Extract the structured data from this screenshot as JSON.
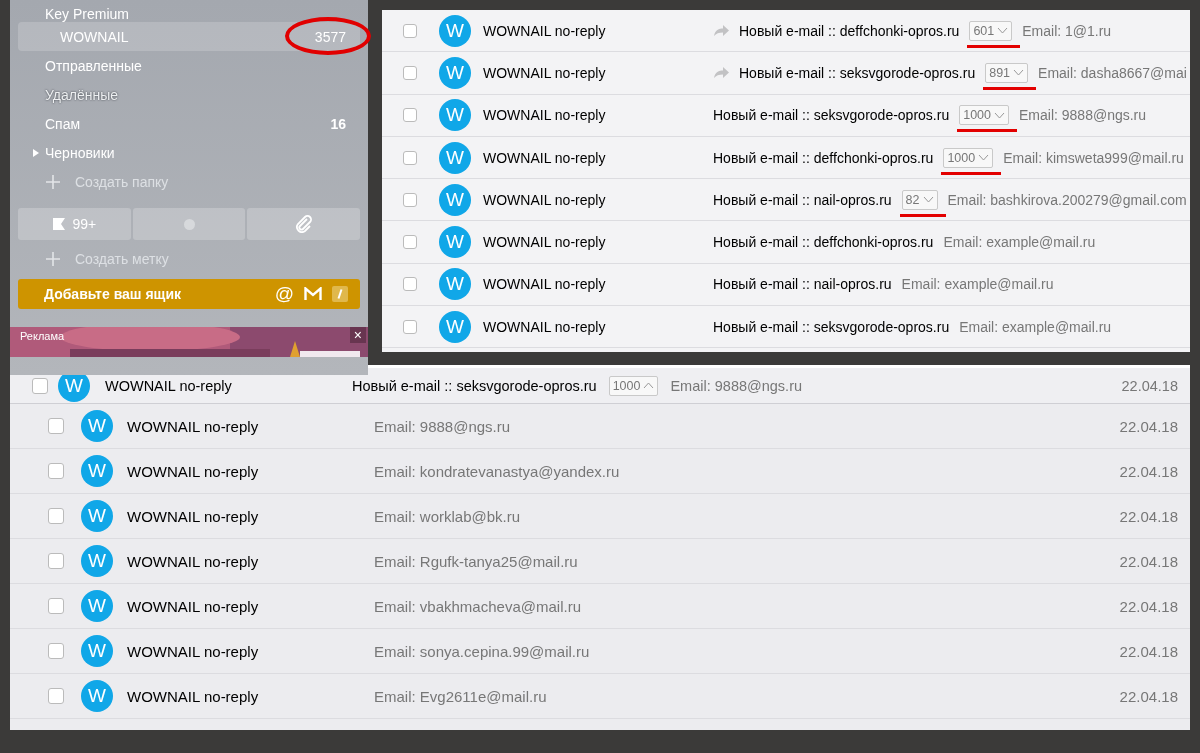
{
  "sidebar": {
    "folders": [
      {
        "kind": "folder",
        "label": "Key Premium",
        "selected": false,
        "dimmed": false
      },
      {
        "kind": "folder",
        "label": "WOWNAIL",
        "count": "3577",
        "selected": true,
        "dimmed": false,
        "annotated": true
      },
      {
        "kind": "folder",
        "label": "Отправленные",
        "selected": false,
        "dimmed": false
      },
      {
        "kind": "folder",
        "label": "Удалённые",
        "selected": false,
        "dimmed": true
      },
      {
        "kind": "folder",
        "label": "Спам",
        "count": "16",
        "selected": false,
        "dimmed": false
      },
      {
        "kind": "tree",
        "label": "Черновики",
        "selected": false,
        "dimmed": false,
        "expanded": false
      },
      {
        "kind": "create",
        "label": "Создать папку"
      }
    ],
    "label_filters": [
      {
        "kind": "flag",
        "label": "99+"
      },
      {
        "kind": "dot"
      },
      {
        "kind": "clip"
      }
    ],
    "create_label": "Создать метку",
    "add_mailbox": {
      "label": "Добавьте ваш ящик",
      "icons": [
        "@"
      ]
    },
    "ad": {
      "label": "Реклама",
      "close": "×"
    }
  },
  "top_list": [
    {
      "avatar": "W",
      "sender": "WOWNAIL no-reply",
      "forwarded": true,
      "subject": "Новый e-mail :: deffchonki-opros.ru",
      "count": "601",
      "expanded": false,
      "annotated": true,
      "snippet": "Email: 1@1.ru",
      "checked": false
    },
    {
      "avatar": "W",
      "sender": "WOWNAIL no-reply",
      "forwarded": true,
      "subject": "Новый e-mail :: seksvgorode-opros.ru",
      "count": "891",
      "expanded": false,
      "annotated": true,
      "snippet": "Email: dasha8667@mai",
      "checked": false
    },
    {
      "avatar": "W",
      "sender": "WOWNAIL no-reply",
      "forwarded": false,
      "subject": "Новый e-mail :: seksvgorode-opros.ru",
      "count": "1000",
      "expanded": false,
      "annotated": true,
      "snippet": "Email: 9888@ngs.ru",
      "checked": false
    },
    {
      "avatar": "W",
      "sender": "WOWNAIL no-reply",
      "forwarded": false,
      "subject": "Новый e-mail :: deffchonki-opros.ru",
      "count": "1000",
      "expanded": false,
      "annotated": true,
      "snippet": "Email: kimsweta999@mail.ru",
      "checked": false
    },
    {
      "avatar": "W",
      "sender": "WOWNAIL no-reply",
      "forwarded": false,
      "subject": "Новый e-mail :: nail-opros.ru",
      "count": "82",
      "expanded": false,
      "annotated": true,
      "snippet": "Email: bashkirova.200279@gmail.com",
      "checked": false
    },
    {
      "avatar": "W",
      "sender": "WOWNAIL no-reply",
      "forwarded": false,
      "subject": "Новый e-mail :: deffchonki-opros.ru",
      "snippet": "Email: example@mail.ru",
      "checked": false
    },
    {
      "avatar": "W",
      "sender": "WOWNAIL no-reply",
      "forwarded": false,
      "subject": "Новый e-mail :: nail-opros.ru",
      "snippet": "Email: example@mail.ru",
      "checked": false
    },
    {
      "avatar": "W",
      "sender": "WOWNAIL no-reply",
      "forwarded": false,
      "subject": "Новый e-mail :: seksvgorode-opros.ru",
      "snippet": "Email: example@mail.ru",
      "checked": false
    }
  ],
  "thread": {
    "avatar": "W",
    "sender": "WOWNAIL no-reply",
    "subject": "Новый e-mail :: seksvgorode-opros.ru",
    "count": "1000",
    "expanded": true,
    "snippet": "Email: 9888@ngs.ru",
    "date": "22.04.18",
    "checked": false,
    "children": [
      {
        "avatar": "W",
        "sender": "WOWNAIL no-reply",
        "snippet": "Email: 9888@ngs.ru",
        "date": "22.04.18",
        "checked": false
      },
      {
        "avatar": "W",
        "sender": "WOWNAIL no-reply",
        "snippet": "Email: kondratevanastya@yandex.ru",
        "date": "22.04.18",
        "checked": false
      },
      {
        "avatar": "W",
        "sender": "WOWNAIL no-reply",
        "snippet": "Email: worklab@bk.ru",
        "date": "22.04.18",
        "checked": false
      },
      {
        "avatar": "W",
        "sender": "WOWNAIL no-reply",
        "snippet": "Email: Rgufk-tanya25@mail.ru",
        "date": "22.04.18",
        "checked": false
      },
      {
        "avatar": "W",
        "sender": "WOWNAIL no-reply",
        "snippet": "Email: vbakhmacheva@mail.ru",
        "date": "22.04.18",
        "checked": false
      },
      {
        "avatar": "W",
        "sender": "WOWNAIL no-reply",
        "snippet": "Email: sonya.cepina.99@mail.ru",
        "date": "22.04.18",
        "checked": false
      },
      {
        "avatar": "W",
        "sender": "WOWNAIL no-reply",
        "snippet": "Email: Evg2611e@mail.ru",
        "date": "22.04.18",
        "checked": false
      }
    ]
  }
}
